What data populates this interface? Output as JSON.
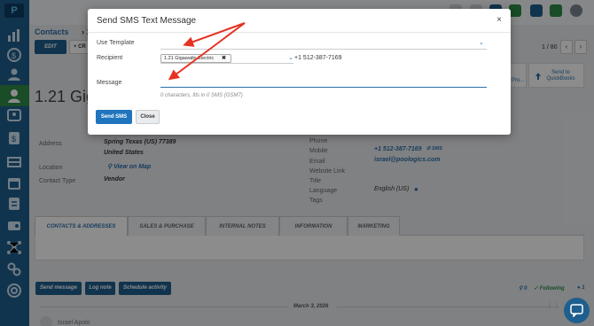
{
  "sidebar": {
    "logo_text": "P",
    "active_index": 4
  },
  "breadcrumb": {
    "section": "Contacts",
    "separator": "›",
    "current": "1."
  },
  "toolbar": {
    "edit_label": "EDIT",
    "create_label": "+ CR",
    "pager_text": "1 / 80",
    "prev": "‹",
    "next": "›"
  },
  "actions_cards": {
    "pro_label": "Pro...",
    "quickbooks_label": "Send to QuickBooks"
  },
  "contact": {
    "title_visible": "1.21 Gig"
  },
  "details_left": {
    "address_label": "Address",
    "address_line1": "Spring  Texas (US)  77389",
    "address_line2": "United States",
    "location_label": "Location",
    "location_link": "View on Map",
    "contact_type_label": "Contact Type",
    "contact_type_value": "Vendor"
  },
  "details_right": {
    "phone_label": "Phone",
    "mobile_label": "Mobile",
    "mobile_value": "+1 512-387-7169",
    "sms_label": "SMS",
    "email_label": "Email",
    "email_value": "israel@poologics.com",
    "website_label": "Website Link",
    "title_label": "Title",
    "language_label": "Language",
    "language_value": "English (US)",
    "tags_label": "Tags"
  },
  "tabs": [
    {
      "label": "CONTACTS & ADDRESSES"
    },
    {
      "label": "SALES & PURCHASE"
    },
    {
      "label": "INTERNAL NOTES"
    },
    {
      "label": "INFORMATION"
    },
    {
      "label": "MARKETING"
    }
  ],
  "chatter": {
    "send_message": "Send message",
    "log_note": "Log note",
    "schedule_activity": "Schedule activity",
    "attachments_count": "0",
    "following_label": "Following",
    "followers_count": "1",
    "date_separator": "March 3, 2026",
    "first_author": "Israel Apolo"
  },
  "modal": {
    "title": "Send SMS Text Message",
    "close_icon": "×",
    "use_template_label": "Use Template",
    "recipient_label": "Recipient",
    "recipient_tag": "1.21 Gigawatts Electric",
    "recipient_number": "+1 512-387-7169",
    "message_label": "Message",
    "message_value": "",
    "message_hint": "0 characters, fits in 0 SMS (GSM7)",
    "send_label": "Send SMS",
    "close_label": "Close"
  },
  "colors": {
    "primary": "#1f5f8f",
    "send_button": "#1f74bd",
    "annotation_arrow": "#e53222",
    "sidebar_active": "#2f8a47",
    "following": "#2f8a47"
  },
  "icons": [
    "search-icon",
    "bell-icon",
    "chat-icon",
    "help-icon",
    "avatar",
    "close-icon",
    "chevron-down-icon",
    "remove-tag-icon",
    "chat-bubble-icon",
    "upload-icon"
  ]
}
